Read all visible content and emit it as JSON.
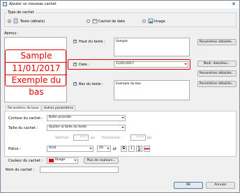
{
  "window": {
    "title": "Ajouter un nouveau cachet"
  },
  "type_group": {
    "legend": "Type de cachet",
    "options": [
      {
        "label": "Texte (détails)",
        "selected": true
      },
      {
        "label": "Cachet de date",
        "selected": false
      },
      {
        "label": "Image",
        "selected": false
      }
    ]
  },
  "preview": {
    "label": "Aperçu :",
    "lines": [
      "Sample",
      "11/01/2017",
      "Exemple du bas"
    ]
  },
  "top_text": {
    "label": "Haut du texte :",
    "checked": true,
    "value": "Sample",
    "button": "Paramètres détaillés..."
  },
  "date": {
    "label": "Date :",
    "checked": true,
    "value": "11/01/2017",
    "modify_button": "Modi. date/Heu...",
    "details_button": "Paramètres détaillés..."
  },
  "bottom_text": {
    "label": "Bas du texte :",
    "checked": true,
    "value": "Exemple du bas",
    "button": "Paramètres détaillés..."
  },
  "tabs": [
    {
      "label": "Paramètres de base",
      "active": true
    },
    {
      "label": "Autres paramètres",
      "active": false
    }
  ],
  "basic": {
    "contour_label": "Contour du cachet :",
    "contour_value": "Boîte arrondie",
    "size_label": "Taille du cachet :",
    "size_value": "Ajuster la taille du texte",
    "vertical_label": "Vertical :",
    "vertical_value": "1,17",
    "horizontal_label": "Horizontal :",
    "horizontal_value": "2,11",
    "unit": "po",
    "font_label": "Police :",
    "font_value": "Arial",
    "font_size": "20",
    "font_unit": "pt",
    "style_buttons": [
      "G",
      "I",
      "S",
      "abc"
    ],
    "color_label": "Couleur du cachet :",
    "color_value": "Rouge",
    "color_hex": "#e00000",
    "more_colors": "Plus de couleurs..."
  },
  "name": {
    "label": "Nom du cachet :",
    "value": ""
  },
  "footer": {
    "ok": "OK",
    "cancel": "Annuler"
  }
}
